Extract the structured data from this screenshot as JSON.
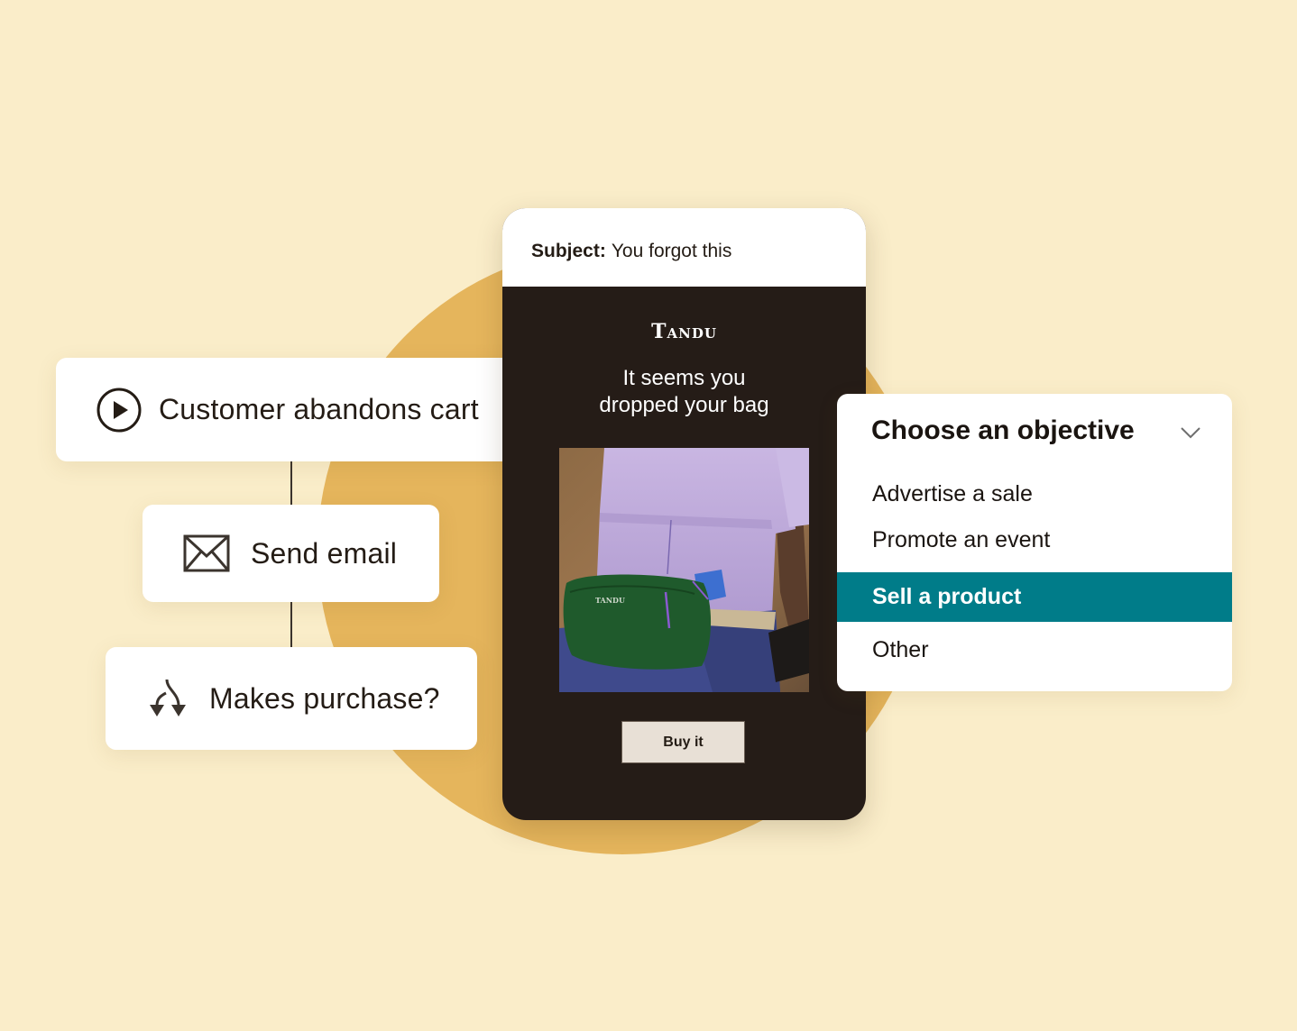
{
  "colors": {
    "background": "#FAEDC9",
    "circle": "#E5B55C",
    "phone_body": "#251C17",
    "selected_option": "#007C89",
    "button_bg": "#E8E0D6",
    "text_dark": "#241C15"
  },
  "workflow": {
    "steps": [
      {
        "label": "Customer abandons cart",
        "icon": "play-circle-icon"
      },
      {
        "label": "Send email",
        "icon": "envelope-icon"
      },
      {
        "label": "Makes purchase?",
        "icon": "branch-split-icon"
      }
    ]
  },
  "email_preview": {
    "subject_key": "Subject:",
    "subject_value": "You forgot this",
    "brand": "Tandu",
    "headline_line1": "It seems you",
    "headline_line2": "dropped your bag",
    "image_alt": "Person wearing green Tandu hip bag",
    "bag_logo": "TANDU",
    "cta_label": "Buy it"
  },
  "objective_dropdown": {
    "title": "Choose an objective",
    "expanded": true,
    "options": [
      {
        "label": "Advertise a sale",
        "selected": false
      },
      {
        "label": "Promote an event",
        "selected": false
      },
      {
        "label": "Sell a product",
        "selected": true
      },
      {
        "label": "Other",
        "selected": false
      }
    ]
  }
}
